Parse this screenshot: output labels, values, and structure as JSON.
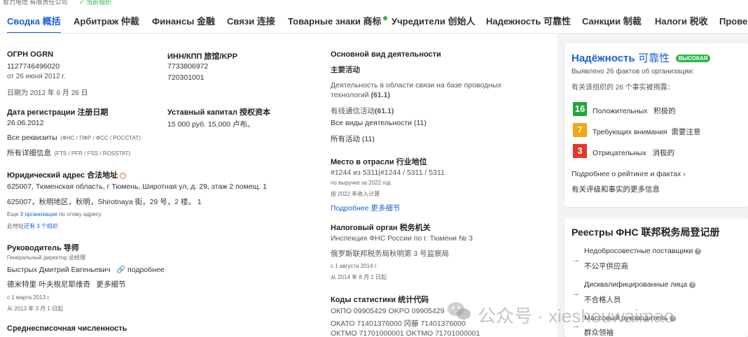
{
  "top_strip": {
    "text": "智力电信 有限责任公司",
    "status": "当前组织"
  },
  "tabs": [
    {
      "label": "Сводка 概括",
      "active": true
    },
    {
      "label": "Арбитраж 仲裁"
    },
    {
      "label": "Финансы 金融"
    },
    {
      "label": "Связи 连接"
    },
    {
      "label": "Товарные знаки 商标",
      "dot": true
    },
    {
      "label": "Учредители 创始人"
    },
    {
      "label": "Надежность 可靠性"
    },
    {
      "label": "Санкции 制裁"
    },
    {
      "label": "Налоги 税收"
    },
    {
      "label": "Провер"
    }
  ],
  "ogrn": {
    "title": "ОГРН OGRN",
    "value": "1127746496020",
    "date": "от 26 июня 2012 г.",
    "date_cn": "日期为 2012 年 6 月 26 日"
  },
  "inn": {
    "title": "ИНН/КПП 旅馆/KPP",
    "value1": "7733806972",
    "value2": "720301001"
  },
  "reg": {
    "title": "Дата регистрации 注册日期",
    "value": "26.06.2012",
    "link": "Все реквизиты",
    "link_note": "(ФНС / ПФР / ФСС / РОССТАТ)",
    "link_cn": "所有详细信息",
    "link_cn_note": "(FTS / PFR / FSS / ROSSTAT)"
  },
  "capital": {
    "title": "Уставный капитал 授权资本",
    "value": "15 000 руб. 15,000 卢布。"
  },
  "address": {
    "title": "Юридический адрес 合法地址",
    "value": "625007, Тюменская область, г Тюмень, Широтная ул, д. 29, этаж 2 помещ. 1",
    "value_cn": "625007，秋明地区，秋明，Shirotnaya 街，29 号，2 楼。 1",
    "more_prefix": "Еще",
    "more_link": "3 организации",
    "more_suffix": "по этому адресу",
    "more_cn_prefix": "此地址",
    "more_cn_link": "还有 3 个组织"
  },
  "head": {
    "title": "Руководитель 导师",
    "role": "Генеральный директор 总经理",
    "name": "Быстрых Дмитрий Евгеньевич",
    "more": "подробнее",
    "name_cn": "德米特里·叶夫根尼耶维奇",
    "more_cn": "更多细节",
    "since": "с 1 марта 2013 г.",
    "since_cn": "从 2013 年 3 月 1 日起"
  },
  "employees": {
    "title": "Среднесписочная численность"
  },
  "activity": {
    "title": "Основной вид деятельности",
    "subtitle": "主要活动",
    "desc1": "Деятельность в области связи на базе проводных",
    "desc2": "технологий",
    "code": "(61.1)",
    "desc_cn": "有线通信活动",
    "code_cn": "(61.1)",
    "all_link": "Все виды деятельности (11)",
    "all_link_cn": "所有活动 (11)"
  },
  "industry": {
    "title": "Место в отрасли 行业地位",
    "value": "#1244 из 5311|#1244 / 5311 / 5311",
    "note": "по выручке за 2022 год",
    "note_cn": "按 2022 年收入计算",
    "link": "Подробнее",
    "link_cn": "更多细节"
  },
  "tax": {
    "title": "Налоговый орган 税务机关",
    "value": "Инспекция ФНС России по г. Тюмени № 3",
    "value_cn": "俄罗斯联邦税务局秋明第 3 号监察局",
    "since": "с 1 августа 2014 г.",
    "since_cn": "从 2014 年 8 月 1 日起"
  },
  "codes": {
    "title": "Коды статистики 统计代码",
    "okpo": "ОКПО     09905429 OKPO 09905429",
    "okato": "ОКАТО   71401376000 冈藤 71401376000",
    "oktmo": "ОКТМО   71701000001 OKTMO 71701000001"
  },
  "reliability": {
    "title": "Надёжность",
    "title_cn": "可靠性",
    "badge": "ВЫСОКАЯ",
    "found": "Выявлено 26 фактов об организации:",
    "found_cn": "有关该组织的 26 个事实被揭露：",
    "positive_count": "16",
    "positive": "Положительных",
    "positive_cn": "积极的",
    "attention_count": "7",
    "attention": "Требующих внимания",
    "attention_cn": "需要注意",
    "negative_count": "3",
    "negative": "Отрицательных",
    "negative_cn": "消极的",
    "link": "Подробнее о рейтинге и фактах",
    "link_cn": "有关评级和事实的更多信息",
    "colors": {
      "positive": "#1fa83a",
      "attention": "#f4a716",
      "negative": "#e6372a"
    }
  },
  "registries": {
    "title": "Реестры ФНС 联邦税务局登记册",
    "items": [
      {
        "label": "Недобросовестные поставщики",
        "label_cn": "不公平供应商"
      },
      {
        "label": "Дисквалифицированные лица",
        "label_cn": "不合格人员"
      },
      {
        "label": "Массовый руководитель",
        "label_cn": "群众领袖"
      }
    ]
  },
  "watermark": {
    "text": "公众号 · xieshouwaimao"
  }
}
